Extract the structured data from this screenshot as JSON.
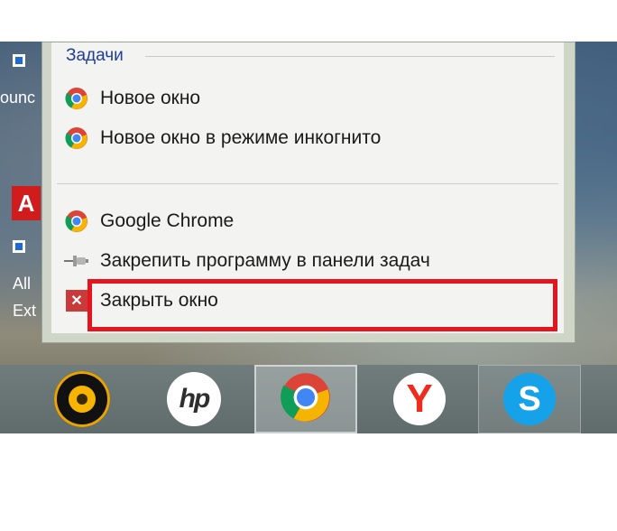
{
  "desktop": {
    "left_labels": [
      "ounc",
      "All",
      "Ext"
    ]
  },
  "jumplist": {
    "header": "Задачи",
    "tasks": [
      {
        "label": "Новое окно",
        "icon": "chrome-icon"
      },
      {
        "label": "Новое окно в режиме инкогнито",
        "icon": "chrome-icon"
      }
    ],
    "app_items": [
      {
        "label": "Google Chrome",
        "icon": "chrome-icon"
      },
      {
        "label": "Закрепить программу в панели задач",
        "icon": "pin-icon"
      },
      {
        "label": "Закрыть окно",
        "icon": "close-icon"
      }
    ],
    "highlight_color": "#e3161f"
  },
  "taskbar": {
    "items": [
      {
        "name": "webcam",
        "icon": "webcam-icon"
      },
      {
        "name": "hp",
        "icon": "hp-icon",
        "text": "hp"
      },
      {
        "name": "chrome",
        "icon": "chrome-icon",
        "active": true
      },
      {
        "name": "yandex",
        "icon": "yandex-icon",
        "text": "Y"
      },
      {
        "name": "skype",
        "icon": "skype-icon",
        "text": "S"
      }
    ]
  }
}
